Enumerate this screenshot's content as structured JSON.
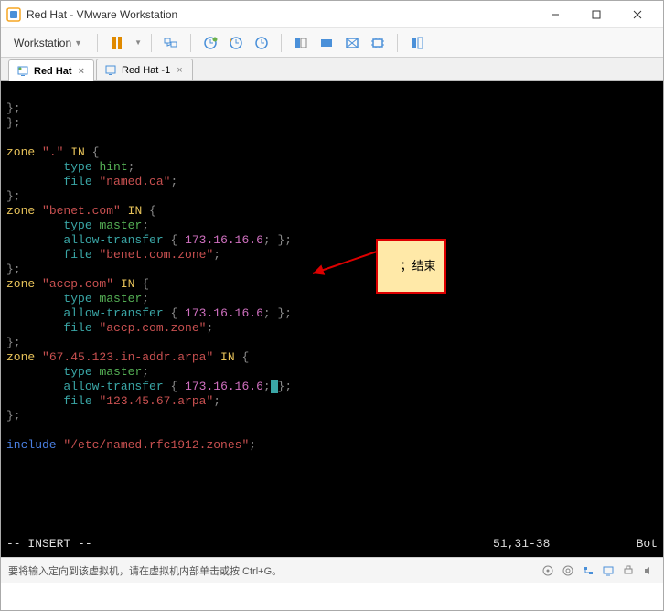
{
  "window": {
    "title": "Red Hat  - VMware Workstation"
  },
  "toolbar": {
    "menu_label": "Workstation"
  },
  "tabs": [
    {
      "label": "Red Hat",
      "active": true
    },
    {
      "label": "Red Hat -1",
      "active": false
    }
  ],
  "terminal": {
    "lines": [
      [],
      [
        {
          "c": "gray",
          "t": "};"
        }
      ],
      [
        {
          "c": "gray",
          "t": "};"
        }
      ],
      [],
      [
        {
          "c": "yellow",
          "t": "zone "
        },
        {
          "c": "str",
          "t": "\".\""
        },
        {
          "c": "yellow",
          "t": " IN "
        },
        {
          "c": "gray",
          "t": "{"
        }
      ],
      [
        {
          "c": "white",
          "t": "        "
        },
        {
          "c": "teal",
          "t": "type"
        },
        {
          "c": "green",
          "t": " hint"
        },
        {
          "c": "gray",
          "t": ";"
        }
      ],
      [
        {
          "c": "white",
          "t": "        "
        },
        {
          "c": "teal",
          "t": "file "
        },
        {
          "c": "str",
          "t": "\"named.ca\""
        },
        {
          "c": "gray",
          "t": ";"
        }
      ],
      [
        {
          "c": "gray",
          "t": "};"
        }
      ],
      [
        {
          "c": "yellow",
          "t": "zone "
        },
        {
          "c": "str",
          "t": "\"benet.com\""
        },
        {
          "c": "yellow",
          "t": " IN "
        },
        {
          "c": "gray",
          "t": "{"
        }
      ],
      [
        {
          "c": "white",
          "t": "        "
        },
        {
          "c": "teal",
          "t": "type"
        },
        {
          "c": "green",
          "t": " master"
        },
        {
          "c": "gray",
          "t": ";"
        }
      ],
      [
        {
          "c": "white",
          "t": "        "
        },
        {
          "c": "teal",
          "t": "allow-transfer "
        },
        {
          "c": "gray",
          "t": "{ "
        },
        {
          "c": "pink",
          "t": "173.16.16.6"
        },
        {
          "c": "gray",
          "t": "; };"
        }
      ],
      [
        {
          "c": "white",
          "t": "        "
        },
        {
          "c": "teal",
          "t": "file "
        },
        {
          "c": "str",
          "t": "\"benet.com.zone\""
        },
        {
          "c": "gray",
          "t": ";"
        }
      ],
      [
        {
          "c": "gray",
          "t": "};"
        }
      ],
      [
        {
          "c": "yellow",
          "t": "zone "
        },
        {
          "c": "str",
          "t": "\"accp.com\""
        },
        {
          "c": "yellow",
          "t": " IN "
        },
        {
          "c": "gray",
          "t": "{"
        }
      ],
      [
        {
          "c": "white",
          "t": "        "
        },
        {
          "c": "teal",
          "t": "type"
        },
        {
          "c": "green",
          "t": " master"
        },
        {
          "c": "gray",
          "t": ";"
        }
      ],
      [
        {
          "c": "white",
          "t": "        "
        },
        {
          "c": "teal",
          "t": "allow-transfer "
        },
        {
          "c": "gray",
          "t": "{ "
        },
        {
          "c": "pink",
          "t": "173.16.16.6"
        },
        {
          "c": "gray",
          "t": "; };"
        }
      ],
      [
        {
          "c": "white",
          "t": "        "
        },
        {
          "c": "teal",
          "t": "file "
        },
        {
          "c": "str",
          "t": "\"accp.com.zone\""
        },
        {
          "c": "gray",
          "t": ";"
        }
      ],
      [
        {
          "c": "gray",
          "t": "};"
        }
      ],
      [
        {
          "c": "yellow",
          "t": "zone "
        },
        {
          "c": "str",
          "t": "\"67.45.123.in-addr.arpa\""
        },
        {
          "c": "yellow",
          "t": " IN "
        },
        {
          "c": "gray",
          "t": "{"
        }
      ],
      [
        {
          "c": "white",
          "t": "        "
        },
        {
          "c": "teal",
          "t": "type"
        },
        {
          "c": "green",
          "t": " master"
        },
        {
          "c": "gray",
          "t": ";"
        }
      ],
      [
        {
          "c": "white",
          "t": "        "
        },
        {
          "c": "teal",
          "t": "allow-transfer "
        },
        {
          "c": "gray",
          "t": "{ "
        },
        {
          "c": "pink",
          "t": "173.16.16.6"
        },
        {
          "c": "gray",
          "t": ";"
        },
        {
          "c": "cursor",
          "t": "_"
        },
        {
          "c": "gray",
          "t": "};"
        }
      ],
      [
        {
          "c": "white",
          "t": "        "
        },
        {
          "c": "teal",
          "t": "file "
        },
        {
          "c": "str",
          "t": "\"123.45.67.arpa\""
        },
        {
          "c": "gray",
          "t": ";"
        }
      ],
      [
        {
          "c": "gray",
          "t": "};"
        }
      ],
      [],
      [
        {
          "c": "blue",
          "t": "include "
        },
        {
          "c": "str",
          "t": "\"/etc/named.rfc1912.zones\""
        },
        {
          "c": "gray",
          "t": ";"
        }
      ]
    ],
    "status_mode": "-- INSERT --",
    "status_pos": "51,31-38",
    "status_right": "Bot"
  },
  "annotation": {
    "text": "；结束"
  },
  "statusbar": {
    "message": "要将输入定向到该虚拟机，请在虚拟机内部单击或按 Ctrl+G。"
  }
}
